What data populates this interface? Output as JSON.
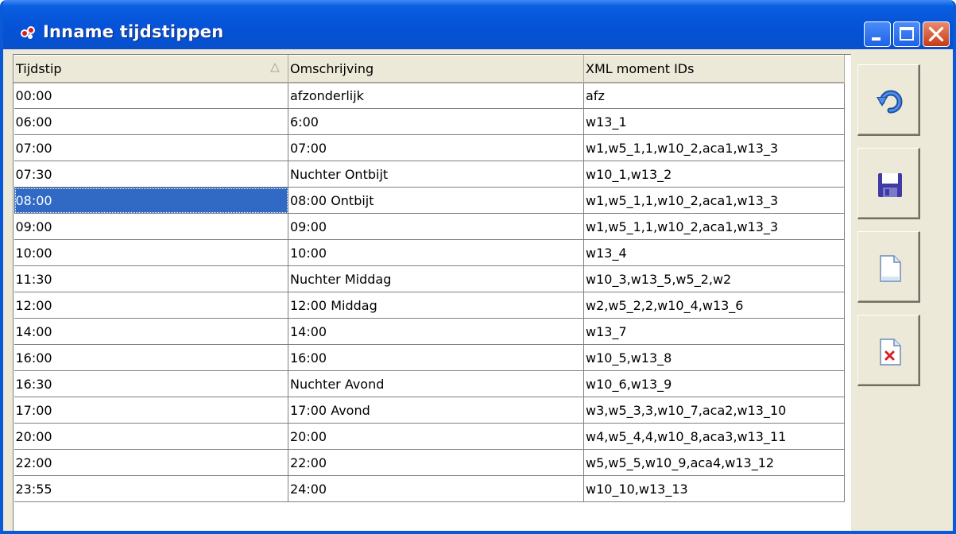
{
  "window": {
    "title": "Inname tijdstippen"
  },
  "grid": {
    "columns": [
      "Tijdstip",
      "Omschrijving",
      "XML moment IDs"
    ],
    "rows": [
      [
        "00:00",
        "afzonderlijk",
        "afz"
      ],
      [
        "06:00",
        "6:00",
        "w13_1"
      ],
      [
        "07:00",
        "07:00",
        "w1,w5_1,1,w10_2,aca1,w13_3"
      ],
      [
        "07:30",
        "Nuchter Ontbijt",
        "w10_1,w13_2"
      ],
      [
        "08:00",
        "08:00 Ontbijt",
        "w1,w5_1,1,w10_2,aca1,w13_3"
      ],
      [
        "09:00",
        "09:00",
        "w1,w5_1,1,w10_2,aca1,w13_3"
      ],
      [
        "10:00",
        "10:00",
        "w13_4"
      ],
      [
        "11:30",
        "Nuchter Middag",
        "w10_3,w13_5,w5_2,w2"
      ],
      [
        "12:00",
        "12:00 Middag",
        "w2,w5_2,2,w10_4,w13_6"
      ],
      [
        "14:00",
        "14:00",
        "w13_7"
      ],
      [
        "16:00",
        "16:00",
        "w10_5,w13_8"
      ],
      [
        "16:30",
        "Nuchter Avond",
        "w10_6,w13_9"
      ],
      [
        "17:00",
        "17:00 Avond",
        "w3,w5_3,3,w10_7,aca2,w13_10"
      ],
      [
        "20:00",
        "20:00",
        "w4,w5_4,4,w10_8,aca3,w13_11"
      ],
      [
        "22:00",
        "22:00",
        "w5,w5_5,w10_9,aca4,w13_12"
      ],
      [
        "23:55",
        "24:00",
        "w10_10,w13_13"
      ]
    ],
    "selected_row": 4,
    "sort_column": 0
  },
  "toolbar": {
    "buttons": [
      {
        "name": "undo-button",
        "icon": "undo-icon"
      },
      {
        "name": "save-button",
        "icon": "save-icon"
      },
      {
        "name": "new-button",
        "icon": "new-document-icon"
      },
      {
        "name": "delete-button",
        "icon": "delete-document-icon"
      }
    ]
  },
  "colors": {
    "titlebar": "#0653d8",
    "selection": "#316ac5",
    "face": "#ece9d8"
  }
}
